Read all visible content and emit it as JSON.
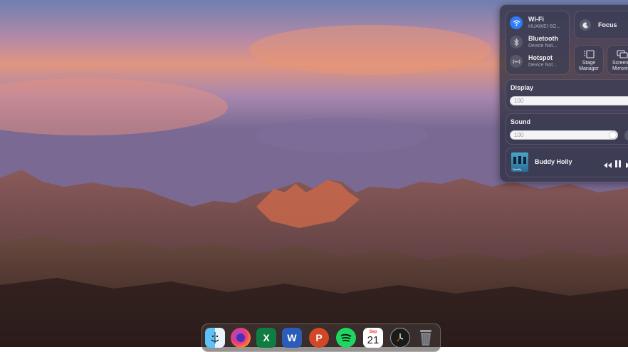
{
  "control_center": {
    "wifi": {
      "title": "Wi-Fi",
      "subtitle": "HUAWEI-5G..."
    },
    "bluetooth": {
      "title": "Bluetooth",
      "subtitle": "Device Not..."
    },
    "hotspot": {
      "title": "Hotspot",
      "subtitle": "Device Not..."
    },
    "focus_label": "Focus",
    "stage_manager_label": "Stage Manager",
    "screen_mirroring_label": "Screen Mirroring",
    "display": {
      "label": "Display",
      "value": "100"
    },
    "sound": {
      "label": "Sound",
      "value": "100"
    },
    "now_playing": {
      "track": "Buddy Holly",
      "app_badge": "Spotify"
    },
    "accent_color": "#2f7cf6"
  },
  "dock": {
    "apps": [
      {
        "name": "Finder"
      },
      {
        "name": "Firefox"
      },
      {
        "name": "Excel",
        "glyph": "X"
      },
      {
        "name": "Word",
        "glyph": "W"
      },
      {
        "name": "PowerPoint",
        "glyph": "P"
      },
      {
        "name": "Spotify"
      },
      {
        "name": "Calendar",
        "month": "Sep",
        "day": "21"
      },
      {
        "name": "Clock"
      },
      {
        "name": "Trash"
      }
    ]
  }
}
